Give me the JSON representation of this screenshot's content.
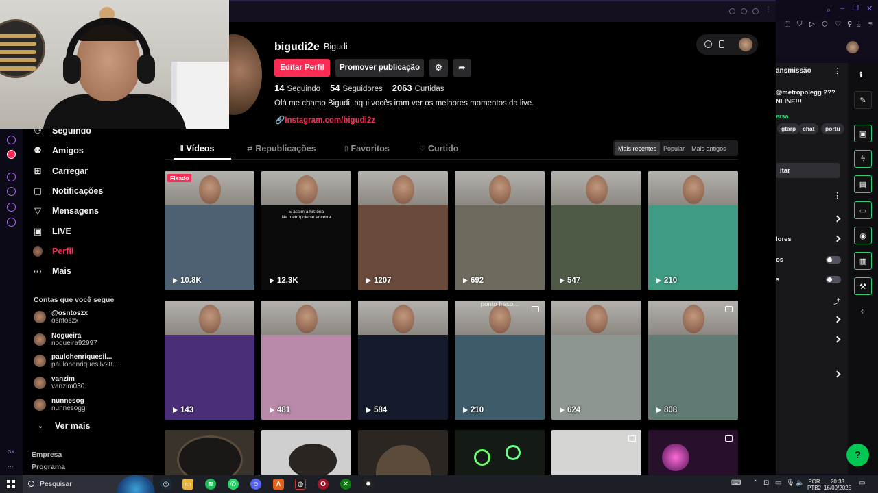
{
  "profile": {
    "username": "bigudi2e",
    "nickname": "Bigudi",
    "edit_label": "Editar Perfil",
    "promote_label": "Promover publicação",
    "following_count": "14",
    "following_label": "Seguindo",
    "followers_count": "54",
    "followers_label": "Seguidores",
    "likes_count": "2063",
    "likes_label": "Curtidas",
    "bio": "Olá me chamo Bigudi, aqui vocês iram ver os melhores momentos da live.",
    "link": "Instagram.com/bigudi2z"
  },
  "nav": {
    "items": [
      {
        "label": "Seguindo",
        "icon": "people-icon"
      },
      {
        "label": "Amigos",
        "icon": "friends-icon"
      },
      {
        "label": "Carregar",
        "icon": "upload-icon"
      },
      {
        "label": "Notificações",
        "icon": "bell-icon"
      },
      {
        "label": "Mensagens",
        "icon": "send-icon"
      },
      {
        "label": "LIVE",
        "icon": "live-icon"
      },
      {
        "label": "Perfil",
        "icon": "avatar"
      },
      {
        "label": "Mais",
        "icon": "more-icon"
      }
    ],
    "following_header": "Contas que você segue",
    "accounts": [
      {
        "name": "@osntoszx",
        "handle": "osntoszx"
      },
      {
        "name": "Nogueira",
        "handle": "nogueira92997"
      },
      {
        "name": "paulohenriquesil...",
        "handle": "paulohenriquesilv28..."
      },
      {
        "name": "vanzim",
        "handle": "vanzim030"
      },
      {
        "name": "nunnesog",
        "handle": "nunnesogg"
      }
    ],
    "see_more": "Ver mais",
    "footer": [
      "Empresa",
      "Programa"
    ]
  },
  "tabs": [
    "Vídeos",
    "Republicações",
    "Favoritos",
    "Curtido"
  ],
  "sort": [
    "Mais recentes",
    "Popular",
    "Mais antigos"
  ],
  "pinned_label": "Fixado",
  "tile_captions": {
    "caption_2": "E assim a história\nNa metrópole se encerra",
    "caption_10": "ponto fraco..."
  },
  "videos": [
    {
      "views": "10.8K",
      "color": "#4d6172"
    },
    {
      "views": "12.3K",
      "color": "#0a0a0a"
    },
    {
      "views": "1207",
      "color": "#6a4a3a"
    },
    {
      "views": "692",
      "color": "#6f6a5e"
    },
    {
      "views": "547",
      "color": "#4f5a46"
    },
    {
      "views": "210",
      "color": "#3f9b84"
    },
    {
      "views": "143",
      "color": "#4a2e78"
    },
    {
      "views": "481",
      "color": "#b889a8"
    },
    {
      "views": "584",
      "color": "#161b2c"
    },
    {
      "views": "210",
      "color": "#3d5b68"
    },
    {
      "views": "624",
      "color": "#8e9691"
    },
    {
      "views": "808",
      "color": "#5f7b74"
    }
  ],
  "side": {
    "header": "ansmissão",
    "title_line1": "@metropolegg ???",
    "title_line2": "NLINE!!!",
    "green": "ersa",
    "chips": [
      "gtarp",
      "chat",
      "portu"
    ],
    "button": "itar",
    "rows": [
      "lores",
      "os",
      "s"
    ]
  },
  "taskbar": {
    "search": "Pesquisar",
    "lang1": "POR",
    "lang2": "PTB2",
    "time": "20:33",
    "date": "16/09/2025"
  },
  "gx_labels": [
    "GX"
  ]
}
